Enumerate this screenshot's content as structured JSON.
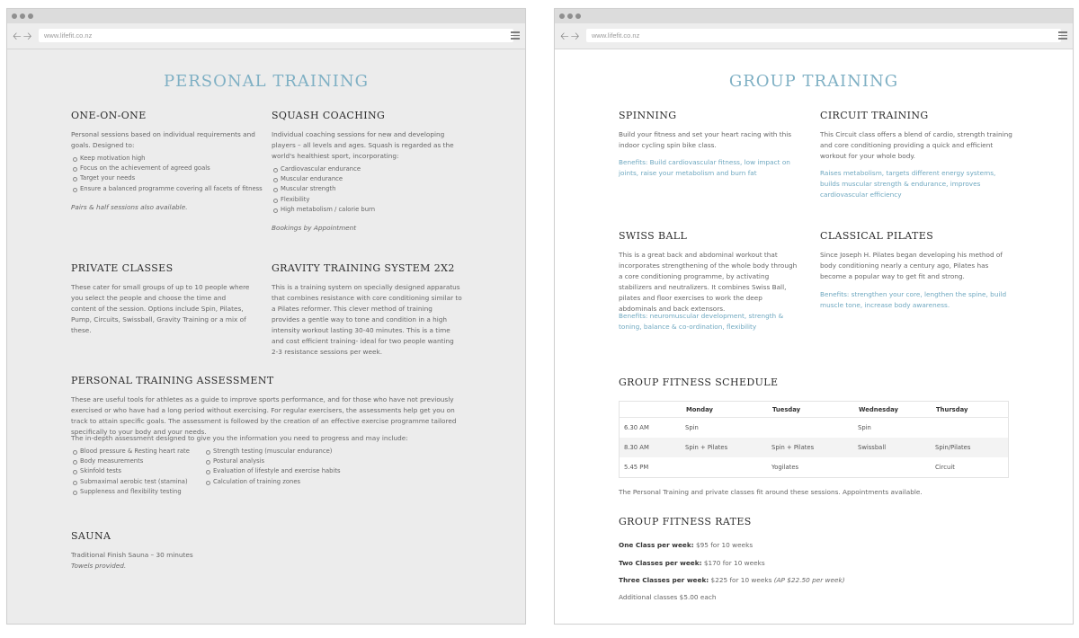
{
  "browser": {
    "url": "www.lifefit.co.nz"
  },
  "left": {
    "title": "PERSONAL TRAINING",
    "one_on_one": {
      "heading": "ONE-ON-ONE",
      "body": "Personal sessions based on individual requirements and goals. Designed to:",
      "bullets": [
        "Keep motivation high",
        "Focus on the achievement of agreed goals",
        "Target your needs",
        "Ensure a balanced programme covering all facets of fitness"
      ],
      "note": "Pairs & half sessions also available."
    },
    "squash": {
      "heading": "SQUASH COACHING",
      "body": "Individual coaching sessions for new and developing players – all levels and ages. Squash is regarded as the world's healthiest sport, incorporating:",
      "bullets": [
        "Cardiovascular endurance",
        "Muscular endurance",
        "Muscular strength",
        "Flexibility",
        "High metabolism / calorie burn"
      ],
      "note": "Bookings by Appointment"
    },
    "private": {
      "heading": "PRIVATE CLASSES",
      "body": "These cater for small groups of up to 10 people where you select the people and choose the time and content of the session. Options include Spin, Pilates, Pump, Circuits, Swissball, Gravity Training or a mix of these."
    },
    "gravity": {
      "heading": "GRAVITY TRAINING SYSTEM 2X2",
      "body": "This is a training system on specially designed apparatus that combines resistance with core conditioning similar to a Pilates reformer. This clever method of training provides a gentle way to tone and condition in a high intensity workout lasting 30-40 minutes. This is a time and cost efficient training- ideal for two people wanting 2-3 resistance sessions per week."
    },
    "assessment": {
      "heading": "PERSONAL TRAINING ASSESSMENT",
      "body": "These are useful tools for athletes as a guide to improve sports performance, and for those who have not previously exercised or who have had a long period without exercising. For regular exercisers, the assessments help get you on track to attain specific goals. The assessment is followed by the creation of an effective exercise programme tailored specifically to your body and your needs.",
      "intro": "The in-depth assessment designed to give you the information you need to progress and may include:",
      "bullets_a": [
        "Blood pressure & Resting heart rate",
        "Body measurements",
        "Skinfold tests",
        "Submaximal aerobic test (stamina)",
        "Suppleness and flexibility testing"
      ],
      "bullets_b": [
        "Strength testing (muscular endurance)",
        "Postural analysis",
        "Evaluation of lifestyle and exercise habits",
        "Calculation of training zones"
      ]
    },
    "sauna": {
      "heading": "SAUNA",
      "body": "Traditional Finish Sauna – 30 minutes",
      "note": "Towels provided."
    }
  },
  "right": {
    "title": "GROUP TRAINING",
    "spinning": {
      "heading": "SPINNING",
      "body": "Build your fitness and set your heart racing with this indoor cycling spin bike class.",
      "benefits": "Benefits: Build cardiovascular fitness, low impact on joints, raise your metabolism and burn fat"
    },
    "circuit": {
      "heading": "CIRCUIT TRAINING",
      "body": "This Circuit class offers a blend of cardio, strength training and core conditioning providing a quick and efficient workout for your whole body.",
      "benefits": "Raises metabolism, targets different energy systems, builds muscular strength & endurance, improves cardiovascular efficiency"
    },
    "swiss": {
      "heading": "SWISS BALL",
      "body": "This is a great back and abdominal workout that incorporates strengthening of the whole body through a core conditioning programme, by activating stabilizers and neutralizers. It combines Swiss Ball, pilates and floor exercises to work the deep abdominals and back extensors.",
      "benefits": "Benefits: neuromuscular development, strength & toning, balance & co-ordination, flexibility"
    },
    "pilates": {
      "heading": "CLASSICAL PILATES",
      "body": "Since Joseph H. Pilates began developing his method of body conditioning nearly a century ago, Pilates has become a popular way to get fit and strong.",
      "benefits": "Benefits: strengthen your core, lengthen the spine, build muscle tone, increase body awareness."
    },
    "schedule": {
      "heading": "GROUP FITNESS SCHEDULE",
      "columns": [
        "",
        "Monday",
        "Tuesday",
        "Wednesday",
        "Thursday"
      ],
      "rows": [
        [
          "6.30 AM",
          "Spin",
          "",
          "Spin",
          ""
        ],
        [
          "8.30 AM",
          "Spin + Pilates",
          "Spin + Pilates",
          "Swissball",
          "Spin/Pilates"
        ],
        [
          "5.45 PM",
          "",
          "Yogilates",
          "",
          "Circuit"
        ]
      ],
      "note": "The Personal Training and private classes fit around these sessions. Appointments available."
    },
    "rates": {
      "heading": "GROUP FITNESS RATES",
      "items": [
        {
          "label": "One Class per week:",
          "value": " $95 for 10 weeks",
          "extra": ""
        },
        {
          "label": "Two Classes per week:",
          "value": " $170 for 10 weeks",
          "extra": ""
        },
        {
          "label": "Three Classes per week:",
          "value": " $225 for 10 weeks ",
          "extra": "(AP $22.50 per week)"
        }
      ],
      "additional": "Additional classes $5.00 each"
    }
  }
}
